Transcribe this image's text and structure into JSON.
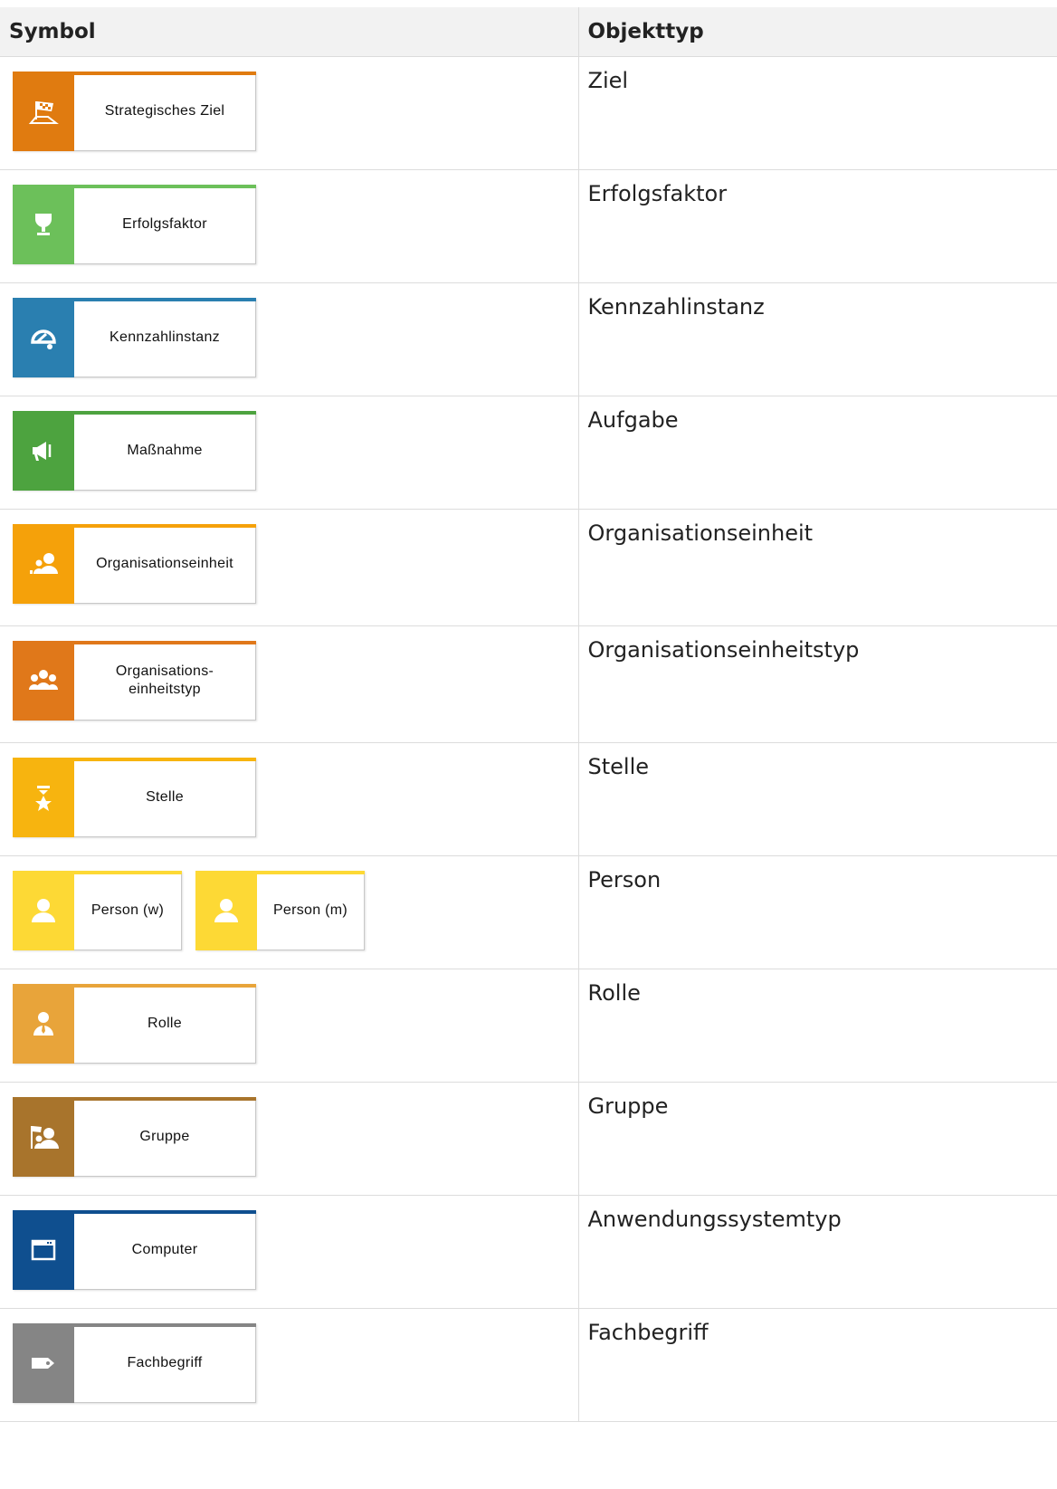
{
  "table": {
    "headers": {
      "symbol": "Symbol",
      "objekttyp": "Objekttyp"
    },
    "rows": [
      {
        "symbols": [
          {
            "label": "Strategisches Ziel",
            "icon": "flag-icon",
            "color": "#e07b10",
            "bar": "#e07b10"
          }
        ],
        "objekttyp": "Ziel"
      },
      {
        "symbols": [
          {
            "label": "Erfolgsfaktor",
            "icon": "trophy-icon",
            "color": "#6cc05a",
            "bar": "#6cc05a"
          }
        ],
        "objekttyp": "Erfolgsfaktor"
      },
      {
        "symbols": [
          {
            "label": "Kennzahlinstanz",
            "icon": "gauge-icon",
            "color": "#2a7fb0",
            "bar": "#2a7fb0"
          }
        ],
        "objekttyp": "Kennzahlinstanz"
      },
      {
        "symbols": [
          {
            "label": "Maßnahme",
            "icon": "megaphone-icon",
            "color": "#4da33f",
            "bar": "#4da33f"
          }
        ],
        "objekttyp": "Aufgabe"
      },
      {
        "symbols": [
          {
            "label": "Organisationseinheit",
            "icon": "org-unit-icon",
            "color": "#f5a10a",
            "bar": "#f5a10a"
          }
        ],
        "objekttyp": "Organisationseinheit"
      },
      {
        "symbols": [
          {
            "label": "Organisations-\neinheitstyp",
            "icon": "org-unit-type-icon",
            "color": "#e0781a",
            "bar": "#e0781a"
          }
        ],
        "objekttyp": "Organisationseinheitstyp"
      },
      {
        "symbols": [
          {
            "label": "Stelle",
            "icon": "position-icon",
            "color": "#f7b40f",
            "bar": "#f7b40f"
          }
        ],
        "objekttyp": "Stelle"
      },
      {
        "symbols": [
          {
            "label": "Person (w)",
            "icon": "person-female-icon",
            "color": "#fdd935",
            "bar": "#fdd935"
          },
          {
            "label": "Person (m)",
            "icon": "person-male-icon",
            "color": "#fdd935",
            "bar": "#fdd935"
          }
        ],
        "objekttyp": "Person"
      },
      {
        "symbols": [
          {
            "label": "Rolle",
            "icon": "role-icon",
            "color": "#e8a43a",
            "bar": "#e8a43a"
          }
        ],
        "objekttyp": "Rolle"
      },
      {
        "symbols": [
          {
            "label": "Gruppe",
            "icon": "group-icon",
            "color": "#a8742c",
            "bar": "#a8742c"
          }
        ],
        "objekttyp": "Gruppe"
      },
      {
        "symbols": [
          {
            "label": "Computer",
            "icon": "window-icon",
            "color": "#0f4f8f",
            "bar": "#0f4f8f"
          }
        ],
        "objekttyp": "Anwendungssystemtyp"
      },
      {
        "symbols": [
          {
            "label": "Fachbegriff",
            "icon": "tag-icon",
            "color": "#858585",
            "bar": "#858585"
          }
        ],
        "objekttyp": "Fachbegriff"
      }
    ]
  }
}
